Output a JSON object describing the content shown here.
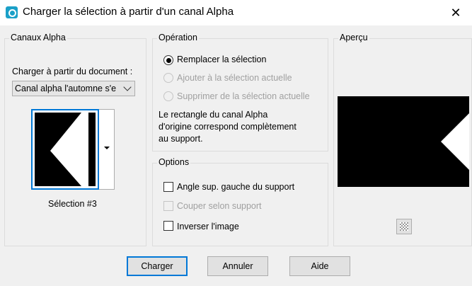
{
  "window": {
    "title": "Charger la sélection à partir d'un canal Alpha",
    "close_glyph": "✕"
  },
  "alpha_channels": {
    "group_title": "Canaux Alpha",
    "load_from_label": "Charger à partir du document :",
    "document_select_value": "Canal alpha l'automne s'e",
    "selection_name": "Sélection #3"
  },
  "operation": {
    "group_title": "Opération",
    "options": [
      {
        "label": "Remplacer la sélection",
        "checked": true,
        "enabled": true
      },
      {
        "label": "Ajouter à la sélection actuelle",
        "checked": false,
        "enabled": false
      },
      {
        "label": "Supprimer de la sélection actuelle",
        "checked": false,
        "enabled": false
      }
    ],
    "info_lines": [
      "Le rectangle du canal Alpha",
      "d'origine correspond complètement",
      "au support."
    ]
  },
  "options": {
    "group_title": "Options",
    "checkboxes": [
      {
        "label": "Angle sup. gauche du support",
        "checked": false,
        "enabled": true
      },
      {
        "label": "Couper selon support",
        "checked": false,
        "enabled": false
      },
      {
        "label": "Inverser l'image",
        "checked": false,
        "enabled": true
      }
    ]
  },
  "preview": {
    "group_title": "Aperçu"
  },
  "buttons": {
    "load": "Charger",
    "cancel": "Annuler",
    "help": "Aide"
  },
  "colors": {
    "accent": "#0078d7",
    "dialog_bg": "#f0f0f0",
    "disabled_text": "#a0a0a0"
  }
}
